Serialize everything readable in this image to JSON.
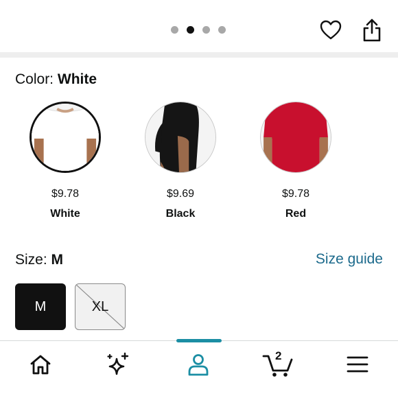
{
  "carousel": {
    "total_dots": 4,
    "active_index": 1
  },
  "header": {
    "favorite_icon": "heart-icon",
    "share_icon": "share-icon"
  },
  "color": {
    "label": "Color:",
    "selected": "White",
    "options": [
      {
        "price": "$9.78",
        "name": "White",
        "shirt_color": "#ffffff",
        "selected": true
      },
      {
        "price": "$9.69",
        "name": "Black",
        "shirt_color": "#151515",
        "selected": false
      },
      {
        "price": "$9.78",
        "name": "Red",
        "shirt_color": "#c8102e",
        "selected": false
      }
    ]
  },
  "size": {
    "label": "Size:",
    "selected": "M",
    "guide_link": "Size guide",
    "options": [
      {
        "label": "M",
        "selected": true,
        "available": true
      },
      {
        "label": "XL",
        "selected": false,
        "available": false
      }
    ]
  },
  "bottom_nav": {
    "items": [
      "home-icon",
      "sparkle-icon",
      "account-icon",
      "cart-icon",
      "menu-icon"
    ],
    "active": "account-icon",
    "cart_count": "2"
  },
  "colors": {
    "accent": "#1b8ea4",
    "link": "#1c6a8c",
    "text": "#0f1111"
  }
}
